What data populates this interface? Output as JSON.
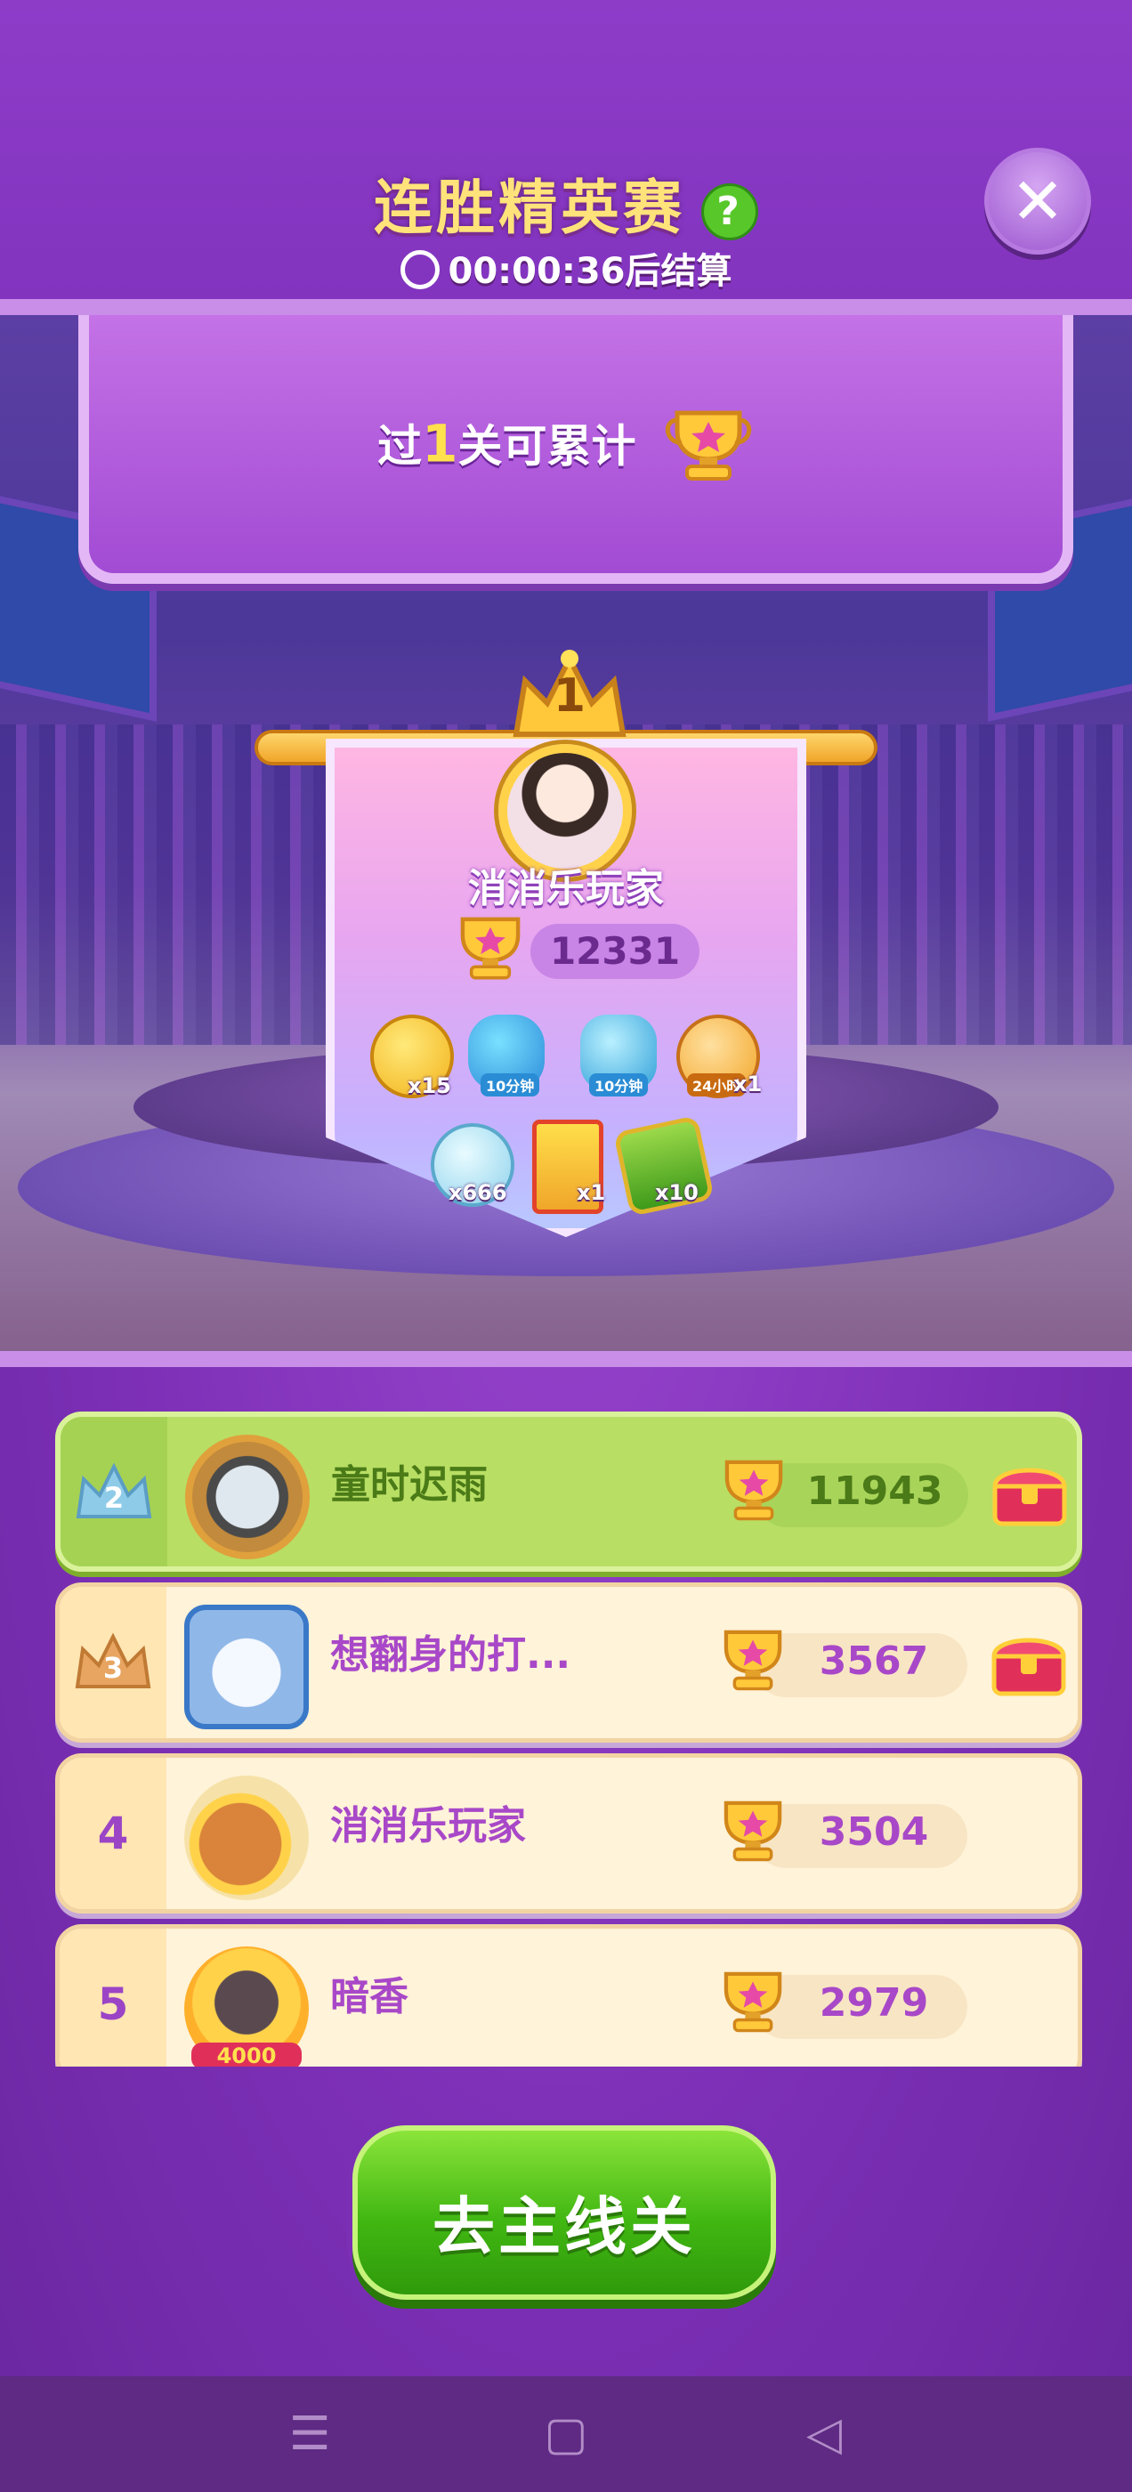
{
  "header": {
    "title": "连胜精英赛",
    "help_icon": "?",
    "countdown": "00:00:36后结算",
    "close_icon": "✕"
  },
  "banner": {
    "prefix": "过",
    "count": "1",
    "suffix": "关可累计"
  },
  "champion": {
    "rank": "1",
    "name": "消消乐玩家",
    "score": "12331",
    "rewards": [
      {
        "icon": "gold-x-coin-icon",
        "count": "x15"
      },
      {
        "icon": "blue-creature-icon",
        "tag": "10分钟"
      },
      {
        "icon": "infinity-bottle-icon",
        "tag": "10分钟"
      },
      {
        "icon": "clock-icon",
        "tag": "24小时",
        "count": "x1"
      },
      {
        "icon": "leaf-coin-icon",
        "count": "x666"
      },
      {
        "icon": "card-pack-icon",
        "count": "x1"
      },
      {
        "icon": "green-leaf-card-icon",
        "count": "x10"
      }
    ]
  },
  "leaderboard": [
    {
      "rank": "2",
      "name": "童时迟雨",
      "score": "11943",
      "chest": true
    },
    {
      "rank": "3",
      "name": "想翻身的打...",
      "score": "3567",
      "chest": true
    },
    {
      "rank": "4",
      "name": "消消乐玩家",
      "score": "3504",
      "chest": false
    },
    {
      "rank": "5",
      "name": "暗香",
      "score": "2979",
      "chest": false,
      "avatar_badge": "4000"
    }
  ],
  "main_button": {
    "label": "去主线关"
  },
  "navbar": {
    "menu": "☰",
    "home": "▢",
    "back": "◁"
  },
  "colors": {
    "background": "#7b2fb5",
    "title": "#ffe37a",
    "first_row": "#b8de64",
    "row": "#fff3d9",
    "score_text": "#a848c8",
    "button": "#41b712"
  }
}
